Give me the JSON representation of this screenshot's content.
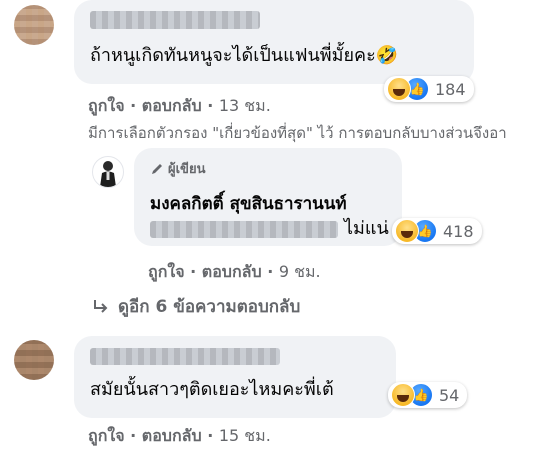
{
  "comments": [
    {
      "text": "ถ้าหนูเกิดทันหนูจะได้เป็นแฟนพี่มั้ยคะ🤣",
      "reactions": {
        "count": "184",
        "icons": [
          "haha-icon",
          "like-icon"
        ]
      },
      "actions": {
        "like": "ถูกใจ",
        "sep": "·",
        "reply": "ตอบกลับ",
        "time": "13 ชม."
      }
    },
    {
      "text": "สมัยนั้นสาวๆติดเยอะไหมคะพี่เต้",
      "reactions": {
        "count": "54",
        "icons": [
          "haha-icon",
          "like-icon"
        ]
      },
      "actions": {
        "like": "ถูกใจ",
        "sep": "·",
        "reply": "ตอบกลับ",
        "time": "15 ชม."
      }
    }
  ],
  "filter_notice": "มีการเลือกตัวกรอง \"เกี่ยวข้องที่สุด\" ไว้ การตอบกลับบางส่วนจึงอา",
  "reply": {
    "badge": "ผู้เขียน",
    "author": "มงคลกิตติ์ สุขสินธารานนท์",
    "text": "ไม่แน่",
    "reactions": {
      "count": "418",
      "icons": [
        "haha-icon",
        "like-icon"
      ]
    },
    "actions": {
      "like": "ถูกใจ",
      "sep": "·",
      "reply": "ตอบกลับ",
      "time": "9 ชม."
    }
  },
  "view_more": "ดูอีก 6 ข้อความตอบกลับ",
  "colors": {
    "bubble": "#f0f2f5",
    "secondary_text": "#65676b",
    "like_blue": "#1877f2",
    "haha_yellow": "#f7b928"
  }
}
